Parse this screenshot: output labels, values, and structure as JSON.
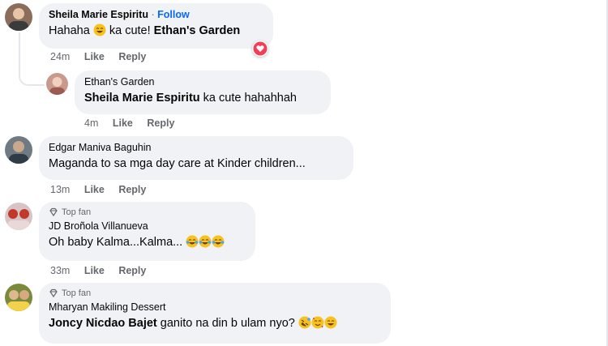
{
  "comments": [
    {
      "name": "Sheila Marie Espiritu",
      "separator": "·",
      "follow": "Follow",
      "text_before": "Hahaha",
      "text_after": "ka cute!",
      "mention": "Ethan's Garden",
      "time": "24m",
      "like": "Like",
      "reply": "Reply"
    },
    {
      "name": "Ethan's Garden",
      "mention": "Sheila Marie Espiritu",
      "text": "ka cute hahahhah",
      "time": "4m",
      "like": "Like",
      "reply": "Reply"
    },
    {
      "name": "Edgar Maniva Baguhin",
      "text": "Maganda to sa mga day care at Kinder children...",
      "time": "13m",
      "like": "Like",
      "reply": "Reply"
    },
    {
      "badge": "Top fan",
      "name": "JD Broñola Villanueva",
      "text": "Oh baby Kalma...Kalma...",
      "time": "33m",
      "like": "Like",
      "reply": "Reply"
    },
    {
      "badge": "Top fan",
      "name": "Mharyan Makiling Dessert",
      "mention": "Joncy Nicdao Bajet",
      "text": "ganito na din b ulam nyo?"
    }
  ],
  "colors": {
    "bubble": "#f0f2f5",
    "link": "#0866ff",
    "secondary": "#65676b",
    "reaction_heart": "#f33e58"
  }
}
